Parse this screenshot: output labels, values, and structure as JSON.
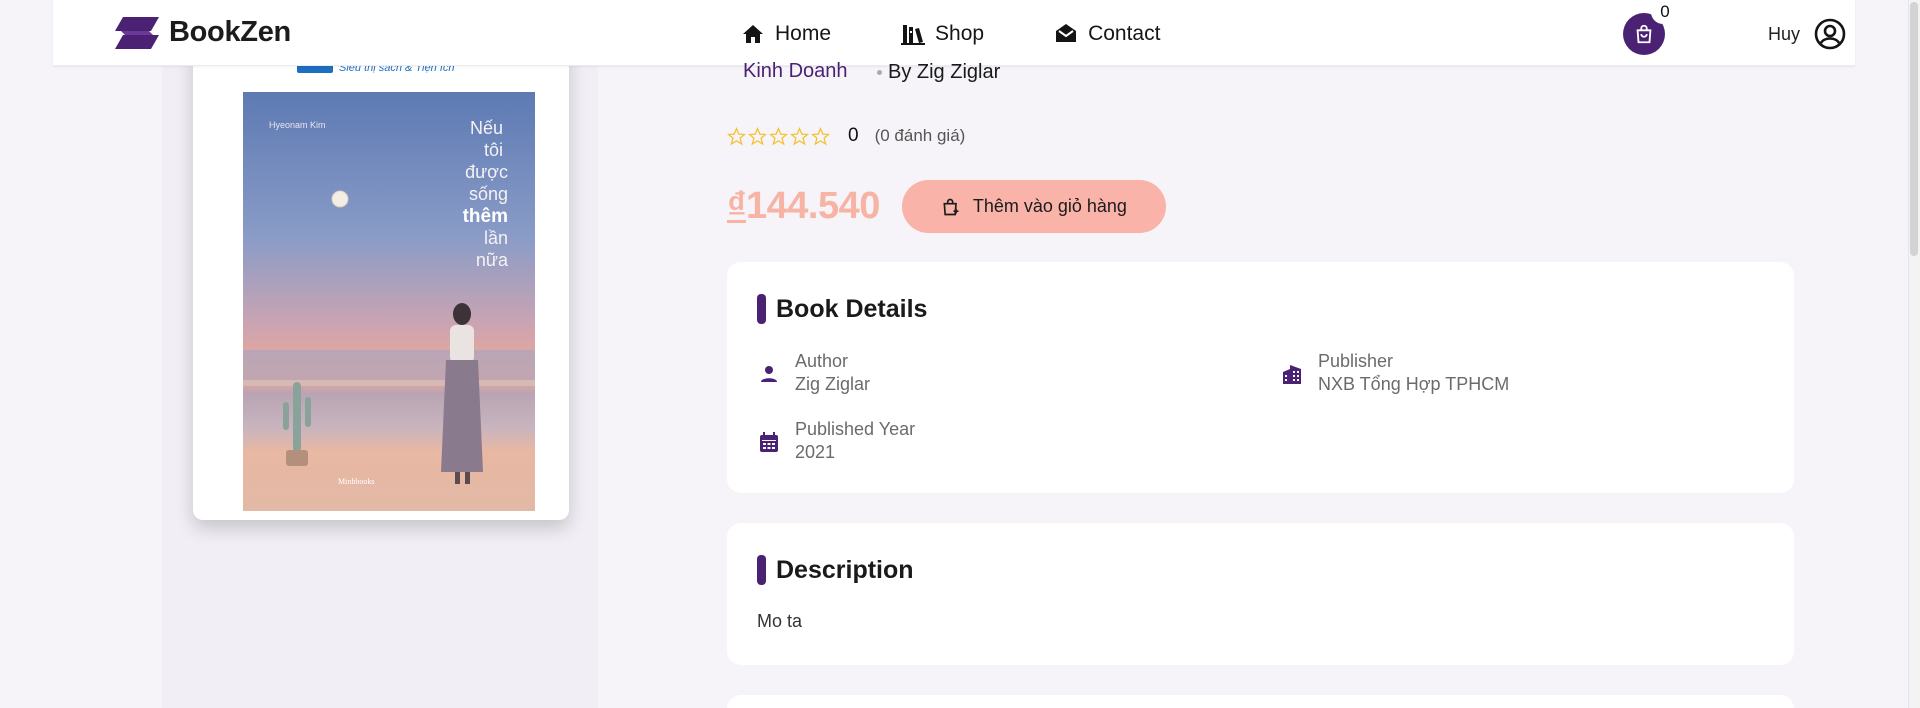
{
  "header": {
    "brand": "BookZen",
    "nav": [
      {
        "label": "Home",
        "icon": "home-icon"
      },
      {
        "label": "Shop",
        "icon": "books-icon"
      },
      {
        "label": "Contact",
        "icon": "mail-icon"
      }
    ],
    "cart_count": "0",
    "user_name": "Huy"
  },
  "book": {
    "cover": {
      "store_tagline": "Siêu thị sách & Tiện ích",
      "author_small": "Hyeonam Kim",
      "title_lines": [
        "Nếu",
        "tôi",
        "được",
        "sống",
        "thêm",
        "lần",
        "nữa"
      ],
      "publisher_mark": "Minhbooks"
    },
    "category": "Kinh Doanh",
    "by": "By Zig Ziglar",
    "rating_value": "0",
    "rating_count": "(0 đánh giá)",
    "price": "144.540",
    "currency": "₫",
    "add_to_cart": "Thêm vào giỏ hàng"
  },
  "details": {
    "title": "Book Details",
    "author_label": "Author",
    "author_value": "Zig Ziglar",
    "publisher_label": "Publisher",
    "publisher_value": "NXB Tổng Hợp TPHCM",
    "year_label": "Published Year",
    "year_value": "2021"
  },
  "description": {
    "title": "Description",
    "text": "Mo ta"
  },
  "colors": {
    "brand": "#4b2273",
    "price": "#f7b3a3",
    "button": "#f9b3a8",
    "star": "#f2c230"
  }
}
